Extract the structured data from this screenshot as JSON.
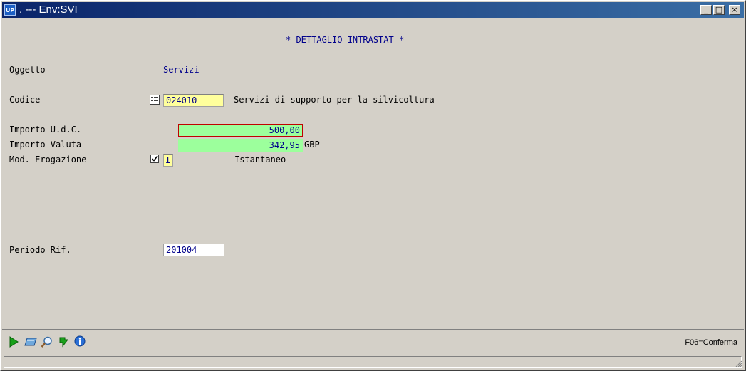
{
  "window": {
    "title": ". --- Env:SVI",
    "app_icon": "UP"
  },
  "titlebar_buttons": {
    "minimize": "_",
    "maximize": "□",
    "close": "×"
  },
  "form": {
    "heading": "* DETTAGLIO INTRASTAT *",
    "oggetto": {
      "label": "Oggetto",
      "value": "Servizi"
    },
    "codice": {
      "label": "Codice",
      "value": "024010",
      "description": "Servizi di supporto per la silvicoltura"
    },
    "importo_udc": {
      "label": "Importo U.d.C.",
      "value": "500,00"
    },
    "importo_valuta": {
      "label": "Importo Valuta",
      "value": "342,95",
      "currency": "GBP"
    },
    "mod_erogazione": {
      "label": "Mod. Erogazione",
      "value": "I",
      "description": "Istantaneo"
    },
    "periodo_rif": {
      "label": "Periodo Rif.",
      "value": "201004"
    }
  },
  "toolbar": {
    "icons": [
      "play-icon",
      "eraser-icon",
      "search-icon",
      "back-arrow-icon",
      "info-icon"
    ],
    "hint": "F06=Conferma"
  },
  "colors": {
    "title_start": "#0a246a",
    "title_end": "#3a6ea5",
    "field_yellow": "#ffff9c",
    "field_green": "#9cff9c",
    "focus_border": "#c00000",
    "text_blue": "#00008b"
  }
}
